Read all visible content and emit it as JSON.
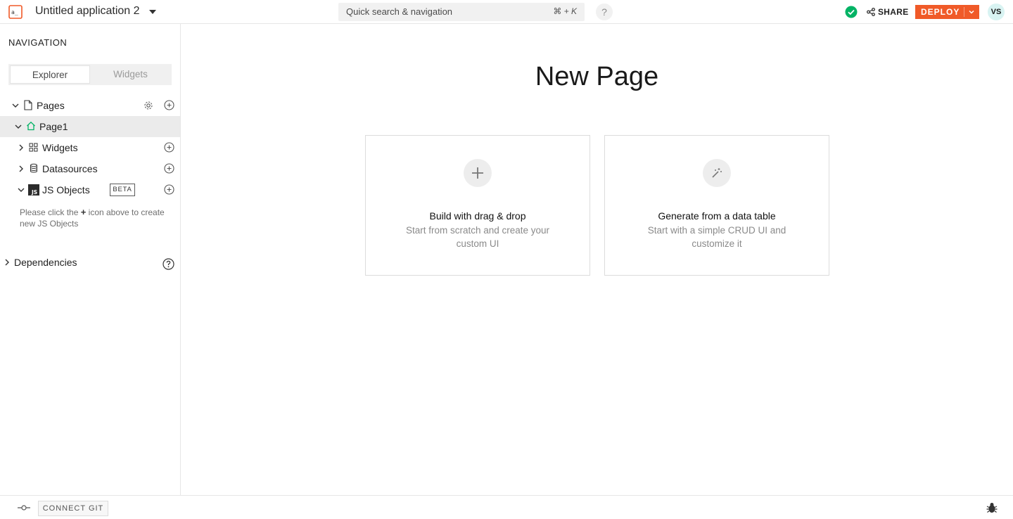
{
  "header": {
    "app_title": "Untitled application 2",
    "search_placeholder": "Quick search & navigation",
    "search_shortcut": "⌘ + K",
    "help_label": "?",
    "share_label": "SHARE",
    "deploy_label": "DEPLOY",
    "avatar_initials": "VS",
    "accent_color": "#f05a28",
    "status_color": "#03b365"
  },
  "sidebar": {
    "heading": "NAVIGATION",
    "tabs": [
      {
        "label": "Explorer",
        "active": true
      },
      {
        "label": "Widgets",
        "active": false
      }
    ],
    "pages_label": "Pages",
    "page_name": "Page1",
    "widgets_label": "Widgets",
    "datasources_label": "Datasources",
    "js_objects_label": "JS Objects",
    "beta_badge": "BETA",
    "js_hint_prefix": "Please click the",
    "js_hint_plus": "+",
    "js_hint_suffix": "icon above to create new JS Objects",
    "dependencies_label": "Dependencies"
  },
  "main": {
    "title": "New Page",
    "cards": [
      {
        "title": "Build with drag & drop",
        "description": "Start from scratch and create your custom UI",
        "icon": "plus-icon"
      },
      {
        "title": "Generate from a data table",
        "description": "Start with a simple CRUD UI and customize it",
        "icon": "magic-wand-icon"
      }
    ]
  },
  "footer": {
    "connect_git_label": "CONNECT GIT"
  }
}
